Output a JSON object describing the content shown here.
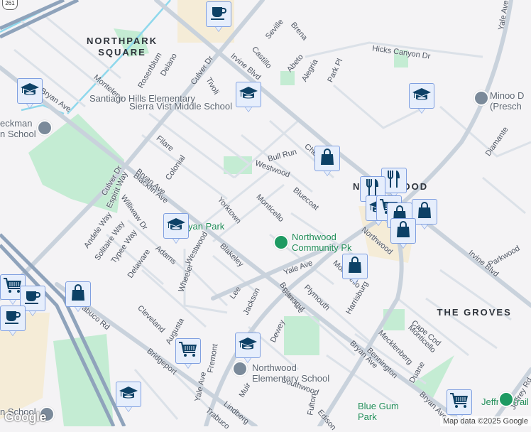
{
  "colors": {
    "background": "#f4f3f5",
    "park": "#c4ecd3",
    "commercial": "#f5ecd7",
    "road": "#d6dde5",
    "arterial": "#c9d2dc",
    "freeway": "#8fa3bb",
    "water": "#8fd8ec",
    "pin_fill": "#e6eefc",
    "pin_border": "#7f9fe0",
    "pin_icon": "#0d4166",
    "park_text": "#1e8a56"
  },
  "route_shield": "261",
  "neighborhoods": [
    "NORTHPARK\nSQUARE",
    "THE GROVES",
    "NORTHWOOD"
  ],
  "streets": [
    "Seville",
    "Brena",
    "Castillo",
    "Abeto",
    "Alegria",
    "Park Pl",
    "Hicks Canyon Dr",
    "Rosenblum",
    "Delano",
    "Culver Dr",
    "Irvine Blvd",
    "Tivoli",
    "Montelena",
    "Bryan Ave",
    "Filare",
    "Colonial",
    "Culver Dr",
    "Bryan Ave",
    "Espirit Way",
    "Blackfin Ave",
    "Williwaw Dr",
    "Bull Run",
    "Ches",
    "Westwood",
    "Bluecoat",
    "Yorktown",
    "Monticello",
    "Northwood",
    "Andele Way",
    "Solitaire Way",
    "Typee Way",
    "Delaware",
    "Adams",
    "Westwood",
    "Wheeler",
    "Blakeley",
    "Lee",
    "Jackson",
    "Cleveland",
    "Augusta",
    "Bridgeport",
    "Trabuco Rd",
    "Trabuco",
    "Yale Ave",
    "Fremont",
    "Muir",
    "Lindberg",
    "Yale Ave",
    "Bryan Ave",
    "Farragut",
    "Plymouth",
    "Monticello",
    "Harrisburg",
    "Dewey",
    "Bryan Ave",
    "Southwood",
    "Fulton",
    "Edison",
    "Cape Cod",
    "Monticello",
    "Mecklenberg",
    "Bennington",
    "Duane",
    "Bryan Ave",
    "Irvine Blvd",
    "Parkwood",
    "Yale Ave",
    "Diamante",
    "Jeffrey Rd"
  ],
  "pois": [
    {
      "name": "Sierra Vist Middle School",
      "type": "school"
    },
    {
      "name": "Santiago Hills Elementary",
      "type": "school"
    },
    {
      "name": "Minoo D\n(Presch",
      "type": "school"
    },
    {
      "name": "eckman\nn School",
      "type": "school"
    },
    {
      "name": "Northwood\nElementary School",
      "type": "school"
    },
    {
      "name": "Northwood\nCommunity Pk",
      "type": "park"
    },
    {
      "name": "Blue Gum\nPark",
      "type": "park"
    },
    {
      "name": "Bryan Park",
      "type": "park"
    },
    {
      "name": "Jeffrey Trail",
      "type": "park"
    },
    {
      "name": "n School",
      "type": "school"
    }
  ],
  "pins": [
    "coffee",
    "school",
    "school",
    "school",
    "shopping-bag",
    "restaurant",
    "restaurant",
    "school",
    "shopping-cart",
    "shopping-bag",
    "shopping-bag",
    "shopping-bag",
    "shopping-bag",
    "school",
    "shopping-cart",
    "coffee",
    "coffee",
    "shopping-bag",
    "shopping-cart",
    "school",
    "school",
    "shopping-cart"
  ],
  "attribution": "Map data ©2025 Google",
  "logo": "Google"
}
